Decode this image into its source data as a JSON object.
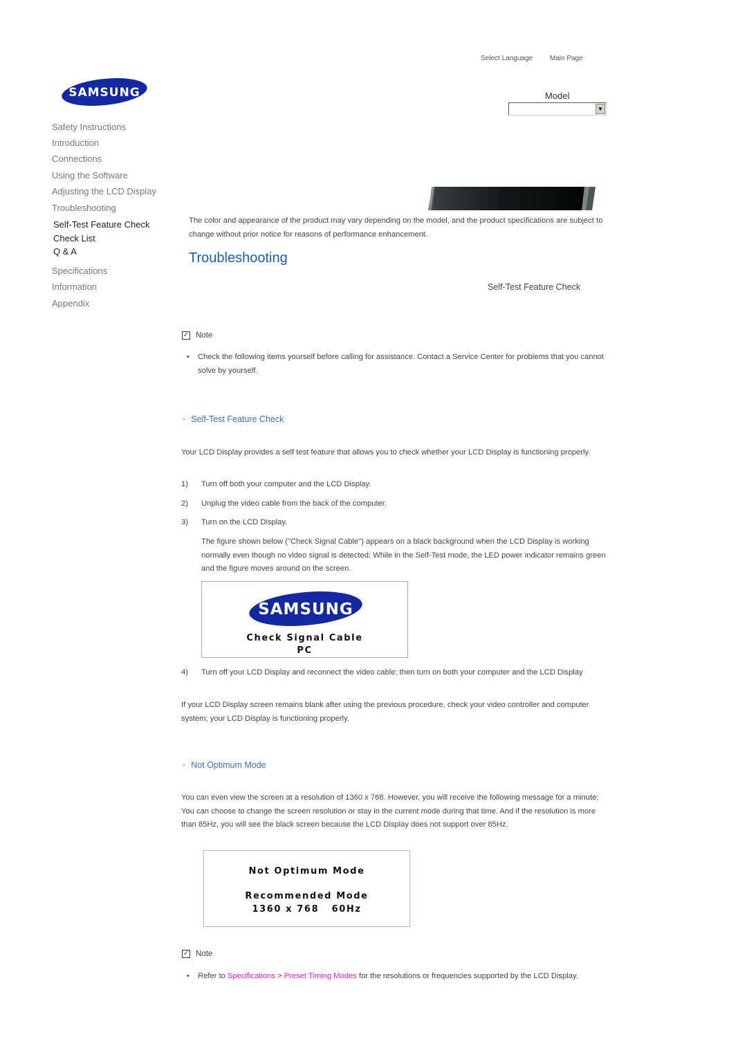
{
  "header": {
    "links": [
      "Select Language",
      "Main Page"
    ],
    "model_label": "Model",
    "model_select_value": ""
  },
  "logo": {
    "text": "SAMSUNG",
    "color": "#1428a0"
  },
  "sidebar": {
    "items": [
      {
        "label": "Safety Instructions"
      },
      {
        "label": "Introduction"
      },
      {
        "label": "Connections"
      },
      {
        "label": "Using the Software"
      },
      {
        "label": "Adjusting the LCD Display"
      },
      {
        "label": "Troubleshooting"
      },
      {
        "label": "Self-Test Feature Check",
        "sub": true
      },
      {
        "label": "Check List",
        "sub": true
      },
      {
        "label": "Q & A",
        "sub": true
      },
      {
        "label": "Specifications"
      },
      {
        "label": "Information"
      },
      {
        "label": "Appendix"
      }
    ]
  },
  "main": {
    "disclaimer": "The color and appearance of the product may vary depending on the model, and the product specifications are subject to change without prior notice for reasons of performance enhancement.",
    "title": "Troubleshooting",
    "breadcrumb": "Self-Test Feature Check",
    "note1": {
      "label": "Note",
      "text": "Check the following items yourself before calling for assistance. Contact a Service Center for problems that you cannot solve by yourself."
    },
    "section1": {
      "heading": "Self-Test Feature Check",
      "intro": "Your LCD Display provides a self test feature that allows you to check whether your LCD Display is functioning properly.",
      "steps": [
        {
          "num": "1)",
          "text": "Turn off both your computer and the LCD Display."
        },
        {
          "num": "2)",
          "text": "Unplug the video cable from the back of the computer."
        },
        {
          "num": "3)",
          "text": "Turn on the LCD Display."
        }
      ],
      "step3_detail": "The figure shown below (\"Check Signal Cable\") appears on a black background when the LCD Display is working normally even though no video signal is detected: While in the Self-Test mode, the LED power indicator remains green and the figure moves around on the screen.",
      "figure": {
        "logo": "SAMSUNG",
        "line1": "Check Signal Cable",
        "line2": "PC"
      },
      "step4": {
        "num": "4)",
        "text": "Turn off your LCD Display and reconnect the video cable; then turn on both your computer and the LCD Display"
      },
      "outro": "If your LCD Display screen remains blank after using the previous procedure, check your video controller and computer system; your LCD Display is functioning properly."
    },
    "section2": {
      "heading": "Not Optimum Mode",
      "intro": "You can even view the screen at a resolution of 1360 x 768. However, you will receive the following message for a minute; You can choose to change the screen resolution or stay in the current mode during that time. And if the resolution is more than 85Hz, you will see the black screen because the LCD Display does not support over 85Hz.",
      "figure": {
        "line1": "Not Optimum Mode",
        "line2": "Recommended Mode",
        "line3": "1360 x 768   60Hz"
      }
    },
    "note2": {
      "label": "Note",
      "prefix": "Refer to ",
      "link1": "Specifications",
      "sep": " > ",
      "link2": "Preset Timing Modes",
      "suffix": " for the resolutions or frequencies supported by the LCD Display."
    }
  }
}
